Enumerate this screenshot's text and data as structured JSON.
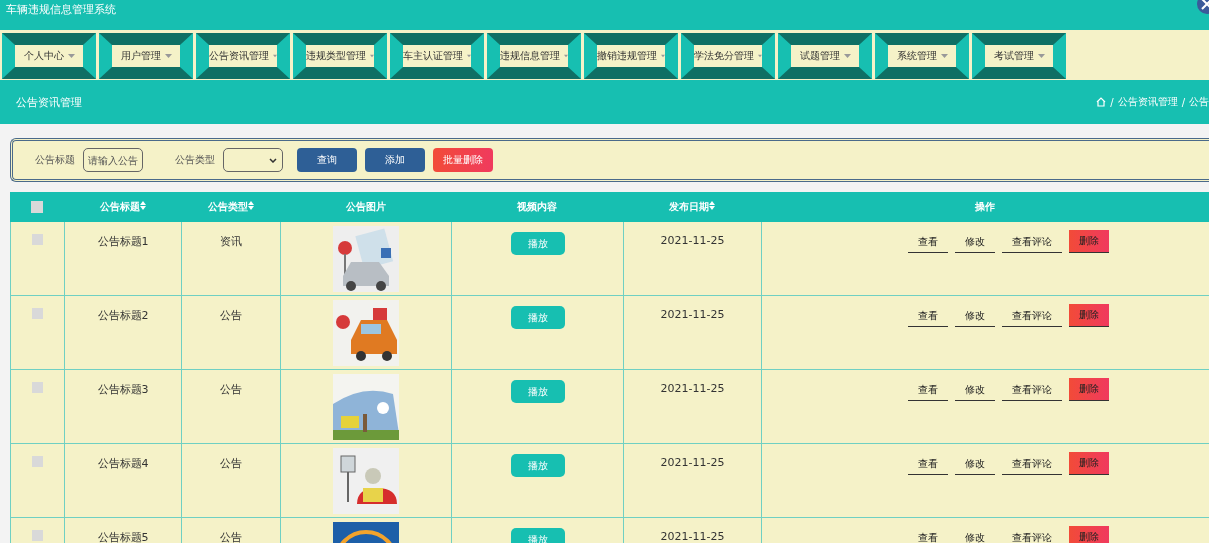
{
  "window": {
    "title": "车辆违规信息管理系统"
  },
  "nav_tabs": [
    {
      "label": "个人中心"
    },
    {
      "label": "用户管理"
    },
    {
      "label": "公告资讯管理"
    },
    {
      "label": "违规类型管理"
    },
    {
      "label": "车主认证管理"
    },
    {
      "label": "违规信息管理"
    },
    {
      "label": "撤销违规管理"
    },
    {
      "label": "学法免分管理"
    },
    {
      "label": "试题管理"
    },
    {
      "label": "系统管理"
    },
    {
      "label": "考试管理"
    }
  ],
  "page_header": {
    "title": "公告资讯管理",
    "separator": "/",
    "breadcrumb": [
      "公告资讯管理",
      "公告"
    ]
  },
  "search": {
    "fields": [
      {
        "kind": "text",
        "label": "公告标题",
        "placeholder": "请输入公告"
      },
      {
        "kind": "select",
        "label": "公告类型"
      }
    ],
    "buttons": [
      {
        "label": "查询",
        "kind": "primary"
      },
      {
        "label": "添加",
        "kind": "primary"
      },
      {
        "label": "批量删除",
        "kind": "danger"
      }
    ]
  },
  "table": {
    "select_all_checked": false,
    "columns": [
      {
        "label": "公告标题",
        "sortable": true
      },
      {
        "label": "公告类型",
        "sortable": true
      },
      {
        "label": "公告图片",
        "sortable": false
      },
      {
        "label": "视频内容",
        "sortable": false
      },
      {
        "label": "发布日期",
        "sortable": true
      },
      {
        "label": "操作",
        "sortable": false
      }
    ],
    "rows": [
      {
        "checked": false,
        "title": "公告标题1",
        "type": "资讯",
        "picture": {
          "kind": "picture"
        },
        "video_button": "播放",
        "date": "2021-11-25",
        "actions": [
          {
            "label": "查看",
            "kind": "link"
          },
          {
            "label": "修改",
            "kind": "link"
          },
          {
            "label": "查看评论",
            "kind": "link"
          },
          {
            "label": "删除",
            "kind": "danger"
          }
        ]
      },
      {
        "checked": false,
        "title": "公告标题2",
        "type": "公告",
        "picture": {
          "kind": "picture"
        },
        "video_button": "播放",
        "date": "2021-11-25",
        "actions": [
          {
            "label": "查看",
            "kind": "link"
          },
          {
            "label": "修改",
            "kind": "link"
          },
          {
            "label": "查看评论",
            "kind": "link"
          },
          {
            "label": "删除",
            "kind": "danger"
          }
        ]
      },
      {
        "checked": false,
        "title": "公告标题3",
        "type": "公告",
        "picture": {
          "kind": "picture"
        },
        "video_button": "播放",
        "date": "2021-11-25",
        "actions": [
          {
            "label": "查看",
            "kind": "link"
          },
          {
            "label": "修改",
            "kind": "link"
          },
          {
            "label": "查看评论",
            "kind": "link"
          },
          {
            "label": "删除",
            "kind": "danger"
          }
        ]
      },
      {
        "checked": false,
        "title": "公告标题4",
        "type": "公告",
        "picture": {
          "kind": "picture"
        },
        "video_button": "播放",
        "date": "2021-11-25",
        "actions": [
          {
            "label": "查看",
            "kind": "link"
          },
          {
            "label": "修改",
            "kind": "link"
          },
          {
            "label": "查看评论",
            "kind": "link"
          },
          {
            "label": "删除",
            "kind": "danger"
          }
        ]
      },
      {
        "checked": false,
        "title": "公告标题5",
        "type": "公告",
        "picture": {
          "kind": "picture"
        },
        "video_button": "播放",
        "date": "2021-11-25",
        "actions": [
          {
            "label": "查看",
            "kind": "link"
          },
          {
            "label": "修改",
            "kind": "link"
          },
          {
            "label": "查看评论",
            "kind": "link"
          },
          {
            "label": "删除",
            "kind": "danger"
          }
        ]
      }
    ]
  }
}
